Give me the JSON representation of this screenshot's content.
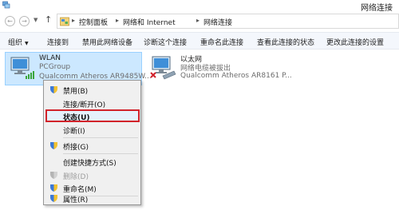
{
  "window": {
    "title": "网络连接"
  },
  "breadcrumb": {
    "items": [
      "控制面板",
      "网络和 Internet",
      "网络连接"
    ]
  },
  "toolbar": {
    "items": [
      "组织",
      "连接到",
      "禁用此网络设备",
      "诊断这个连接",
      "重命名此连接",
      "查看此连接的状态",
      "更改此连接的设置"
    ]
  },
  "connections": [
    {
      "name": "WLAN",
      "network": "PCGroup",
      "adapter": "Qualcomm Atheros AR9485W...",
      "selected": true
    },
    {
      "name": "以太网",
      "network": "网络电缆被拔出",
      "adapter": "Qualcomm Atheros AR8161 P...",
      "selected": false
    }
  ],
  "context_menu": {
    "items": [
      {
        "label": "禁用(B)",
        "icon": "shield-icon",
        "bold": false,
        "disabled": false
      },
      {
        "label": "连接/断开(O)",
        "icon": "none",
        "bold": false,
        "disabled": false
      },
      {
        "label": "状态(U)",
        "icon": "none",
        "bold": true,
        "disabled": false,
        "highlighted": true
      },
      {
        "label": "诊断(I)",
        "icon": "none",
        "bold": false,
        "disabled": false
      },
      {
        "label": "桥接(G)",
        "icon": "shield-icon",
        "bold": false,
        "disabled": false
      },
      {
        "label": "创建快捷方式(S)",
        "icon": "none",
        "bold": false,
        "disabled": false
      },
      {
        "label": "删除(D)",
        "icon": "shield-icon",
        "bold": false,
        "disabled": true
      },
      {
        "label": "重命名(M)",
        "icon": "shield-icon",
        "bold": false,
        "disabled": false
      },
      {
        "label": "属性(R)",
        "icon": "shield-icon",
        "bold": false,
        "disabled": false
      }
    ]
  },
  "colors": {
    "selection": "#cce8ff",
    "highlight_border": "#d2232a",
    "toolbar_bg": "#f4f7fc"
  }
}
